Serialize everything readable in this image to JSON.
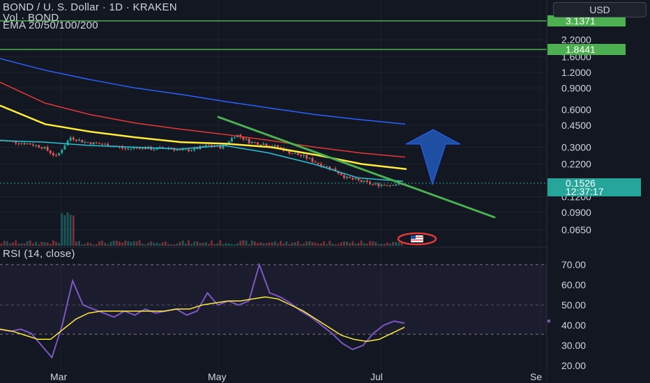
{
  "header": {
    "symbol_title": "BOND / U. S. Dollar · 1D · KRAKEN",
    "volume_label": "Vol · BOND",
    "ema_label": "EMA 20/50/100/200"
  },
  "currency_button": "USD",
  "rsi_label": "RSI (14, close)",
  "current_price": {
    "value": "0.1526",
    "countdown": "12:37:17",
    "color": "#26a69a"
  },
  "horizontal_levels": [
    {
      "price": "3.1371",
      "color": "#4caf50"
    },
    {
      "price": "1.8441",
      "color": "#4caf50"
    }
  ],
  "colors": {
    "background": "#131722",
    "up": "#26a69a",
    "down": "#ef5350",
    "ema20": "#26c6da",
    "ema50": "#ffeb3b",
    "ema100": "#e53935",
    "ema200": "#2962ff",
    "trendline": "#4caf50",
    "arrow": "#1e4fa3",
    "rsi": "#7e57c2",
    "rsi_ma": "#ffeb3b"
  },
  "icons": [
    "arrow-up-icon",
    "flag-event-icon"
  ],
  "chart_data": [
    {
      "type": "candlestick",
      "title": "BOND / U. S. Dollar · 1D · KRAKEN",
      "scale": "log",
      "y_ticks": [
        "2.2000",
        "1.6000",
        "1.2000",
        "0.9000",
        "0.6000",
        "0.4500",
        "0.3000",
        "0.2200",
        "0.1200",
        "0.0900",
        "0.0650"
      ],
      "x_ticks": [
        "Mar",
        "May",
        "Jul",
        "Se"
      ],
      "series": [
        {
          "name": "EMA 20",
          "values_approx": [
            0.34,
            0.33,
            0.31,
            0.3,
            0.29,
            0.31,
            0.27,
            0.22,
            0.17,
            0.16
          ]
        },
        {
          "name": "EMA 50",
          "values_approx": [
            0.65,
            0.46,
            0.4,
            0.36,
            0.33,
            0.32,
            0.3,
            0.26,
            0.22,
            0.2
          ]
        },
        {
          "name": "EMA 100",
          "values_approx": [
            1.0,
            0.68,
            0.55,
            0.47,
            0.42,
            0.38,
            0.34,
            0.3,
            0.27,
            0.25
          ]
        },
        {
          "name": "EMA 200",
          "values_approx": [
            1.55,
            1.25,
            1.05,
            0.9,
            0.8,
            0.7,
            0.62,
            0.55,
            0.5,
            0.46
          ]
        }
      ],
      "close_series_approx": [
        0.34,
        0.33,
        0.32,
        0.3,
        0.25,
        0.36,
        0.33,
        0.32,
        0.31,
        0.29,
        0.3,
        0.29,
        0.3,
        0.28,
        0.29,
        0.31,
        0.3,
        0.38,
        0.33,
        0.32,
        0.3,
        0.27,
        0.25,
        0.22,
        0.2,
        0.17,
        0.16,
        0.15,
        0.15,
        0.1526
      ],
      "last_price": 0.1526
    },
    {
      "type": "line",
      "title": "RSI (14, close)",
      "y_ticks": [
        "70.00",
        "60.00",
        "50.00",
        "40.00",
        "30.00",
        "20.00"
      ],
      "band": [
        30,
        70
      ],
      "series": [
        {
          "name": "RSI",
          "values_approx": [
            38,
            37,
            38,
            36,
            30,
            24,
            40,
            62,
            50,
            48,
            46,
            44,
            47,
            45,
            48,
            46,
            47,
            48,
            45,
            47,
            56,
            50,
            52,
            50,
            52,
            70,
            56,
            54,
            51,
            47,
            44,
            40,
            36,
            31,
            28,
            30,
            36,
            40,
            42,
            41
          ]
        },
        {
          "name": "RSI MA",
          "values_approx": [
            38,
            37,
            35,
            33,
            33,
            38,
            43,
            46,
            47,
            47,
            47,
            47,
            47,
            47,
            48,
            48,
            50,
            51,
            52,
            52,
            53,
            54,
            53,
            50,
            47,
            43,
            39,
            35,
            33,
            32,
            33,
            36,
            39
          ]
        }
      ],
      "last_value": 40.5
    }
  ]
}
